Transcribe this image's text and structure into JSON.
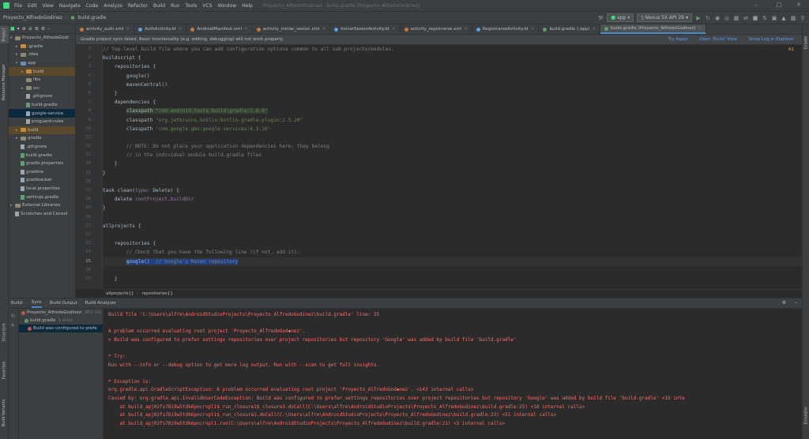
{
  "menu": {
    "items": [
      "File",
      "Edit",
      "View",
      "Navigate",
      "Code",
      "Analyze",
      "Refactor",
      "Build",
      "Run",
      "Tools",
      "VCS",
      "Window",
      "Help"
    ],
    "window_title": "Proyecto_AlfredoGodinez - build.gradle (Proyecto_AlfredoGodinez)"
  },
  "nav": {
    "project": "Proyecto_AlfredoGodinez",
    "file": "build.gradle",
    "run_config": "app",
    "device": "Nexus 5X API 29"
  },
  "project_panel": {
    "title": "Project",
    "rows": [
      {
        "label": "Proyecto_AlfredoGodi",
        "indent": 0,
        "icon": "folder",
        "arrow": "v"
      },
      {
        "label": ".gradle",
        "indent": 1,
        "icon": "folder-orange",
        "arrow": ">"
      },
      {
        "label": ".idea",
        "indent": 1,
        "icon": "folder",
        "arrow": ">"
      },
      {
        "label": "app",
        "indent": 1,
        "icon": "folder-blue",
        "arrow": "v"
      },
      {
        "label": "build",
        "indent": 2,
        "icon": "folder-orange",
        "arrow": ">",
        "style": "orange"
      },
      {
        "label": "libs",
        "indent": 2,
        "icon": "folder",
        "arrow": ""
      },
      {
        "label": "src",
        "indent": 2,
        "icon": "folder",
        "arrow": ">"
      },
      {
        "label": ".gitignore",
        "indent": 2,
        "icon": "file",
        "arrow": ""
      },
      {
        "label": "build.gradle",
        "indent": 2,
        "icon": "gradle",
        "arrow": ""
      },
      {
        "label": "google-service",
        "indent": 2,
        "icon": "file",
        "arrow": "",
        "style": "sel"
      },
      {
        "label": "proguard-rules",
        "indent": 2,
        "icon": "file",
        "arrow": ""
      },
      {
        "label": "build",
        "indent": 1,
        "icon": "folder-orange",
        "arrow": ">",
        "style": "orange"
      },
      {
        "label": "gradle",
        "indent": 1,
        "icon": "folder",
        "arrow": ">"
      },
      {
        "label": ".gitignore",
        "indent": 1,
        "icon": "file",
        "arrow": ""
      },
      {
        "label": "build.gradle",
        "indent": 1,
        "icon": "gradle",
        "arrow": ""
      },
      {
        "label": "gradle.properties",
        "indent": 1,
        "icon": "gradle",
        "arrow": ""
      },
      {
        "label": "gradlew",
        "indent": 1,
        "icon": "file",
        "arrow": ""
      },
      {
        "label": "gradlew.bat",
        "indent": 1,
        "icon": "file",
        "arrow": ""
      },
      {
        "label": "local.properties",
        "indent": 1,
        "icon": "file",
        "arrow": ""
      },
      {
        "label": "settings.gradle",
        "indent": 1,
        "icon": "gradle",
        "arrow": ""
      },
      {
        "label": "External Libraries",
        "indent": 0,
        "icon": "folder",
        "arrow": ">"
      },
      {
        "label": "Scratches and Consol",
        "indent": 0,
        "icon": "file",
        "arrow": ""
      }
    ]
  },
  "tabs": [
    {
      "label": "activity_auth.xml",
      "color": "#cc7832"
    },
    {
      "label": "AuthActivity.kt",
      "color": "#589df6"
    },
    {
      "label": "AndroidManifest.xml",
      "color": "#cc7832"
    },
    {
      "label": "activity_iniciar_sesion.xml",
      "color": "#cc7832"
    },
    {
      "label": "IniciarSesionActivity.kt",
      "color": "#589df6"
    },
    {
      "label": "activity_registrarse.xml",
      "color": "#cc7832"
    },
    {
      "label": "RegistrarseActivity.kt",
      "color": "#589df6"
    },
    {
      "label": "build.gradle (:app)",
      "color": "#5f9e6e"
    },
    {
      "label": "build.gradle (Proyecto_AlfredoGodinez)",
      "color": "#5f9e6e",
      "active": true
    }
  ],
  "banner": {
    "message": "Gradle project sync failed. Basic functionality (e.g. editing, debugging) will not work properly.",
    "try_again": "Try Again",
    "open_build_view": "Open 'Build' View",
    "show_log": "Show Log in Explorer"
  },
  "editor": {
    "line_numbers": [
      "1",
      "2",
      "3",
      "4",
      "5",
      "6",
      "7",
      "8",
      "9",
      "10",
      "11",
      "12",
      "13",
      "14",
      "15",
      "16",
      "17",
      "18",
      "19",
      "20",
      "21",
      "22",
      "23",
      "24",
      "25",
      "26",
      "27"
    ],
    "breadcrumb": [
      "allprojects{}",
      "repositories{}"
    ],
    "inspection": "A1"
  },
  "build": {
    "tabs": [
      "Build:",
      "Sync",
      "Build Output",
      "Build Analyzer"
    ],
    "tree": [
      {
        "label": "Proyecto_AlfredoGodinez:",
        "time": "852 ms",
        "icon": "err"
      },
      {
        "label": "build.gradle",
        "note": "1 error",
        "icon": "ok"
      },
      {
        "label": "Build was configured to prefe",
        "icon": "err",
        "sel": true
      }
    ],
    "console": [
      "Build file 'C:\\Users\\alfre\\AndroidStudioProjects\\Proyecto_AlfredoGodinez\\build.gradle' line: 25",
      "",
      "A problem occurred evaluating root project 'Proyecto_AlfredoGod◆nez'.",
      "> Build was configured to prefer settings repositories over project repositories but repository 'Google' was added by build file 'build.gradle'",
      "",
      "* Try:",
      "Run with --info or --debug option to get more log output. Run with --scan to get full insights.",
      "",
      "* Exception is:",
      "org.gradle.api.GradleScriptException: A problem occurred evaluating root project 'Proyecto_AlfredoGod◆nez'. <143 internal calls>",
      "Caused by: org.gradle.api.InvalidUserCodeException: Build was configured to prefer settings repositories over project repositories but repository 'Google' was added by build file 'build.gradle' <19 inte",
      "    at build_apj02fs78i9w5tdk6pncrvpl1$_run_closure1$_closure3.doCall(C:\\Users\\alfre\\AndroidStudioProjects\\Proyecto_AlfredoGodinez\\build.gradle:25) <18 internal calls>",
      "    at build_apj02fs78i9w5tdk6pncrvpl1$_run_closure2.doCall(C:\\Users\\alfre\\AndroidStudioProjects\\Proyecto_AlfredoGodinez\\build.gradle:23) <51 internal calls>",
      "    at build_apj02fs78i9w5tdk6pncrvpl1.run(C:\\Users\\alfre\\AndroidStudioProjects\\Proyecto_AlfredoGodinez\\build.gradle:21) <3 internal calls>"
    ]
  },
  "side_tabs": {
    "left_top": [
      "Project",
      "Resource Manager"
    ],
    "left_bottom": [
      "Structure",
      "Favorites",
      "Build Variants"
    ],
    "right": [
      "Gradle",
      "Emulator"
    ]
  }
}
